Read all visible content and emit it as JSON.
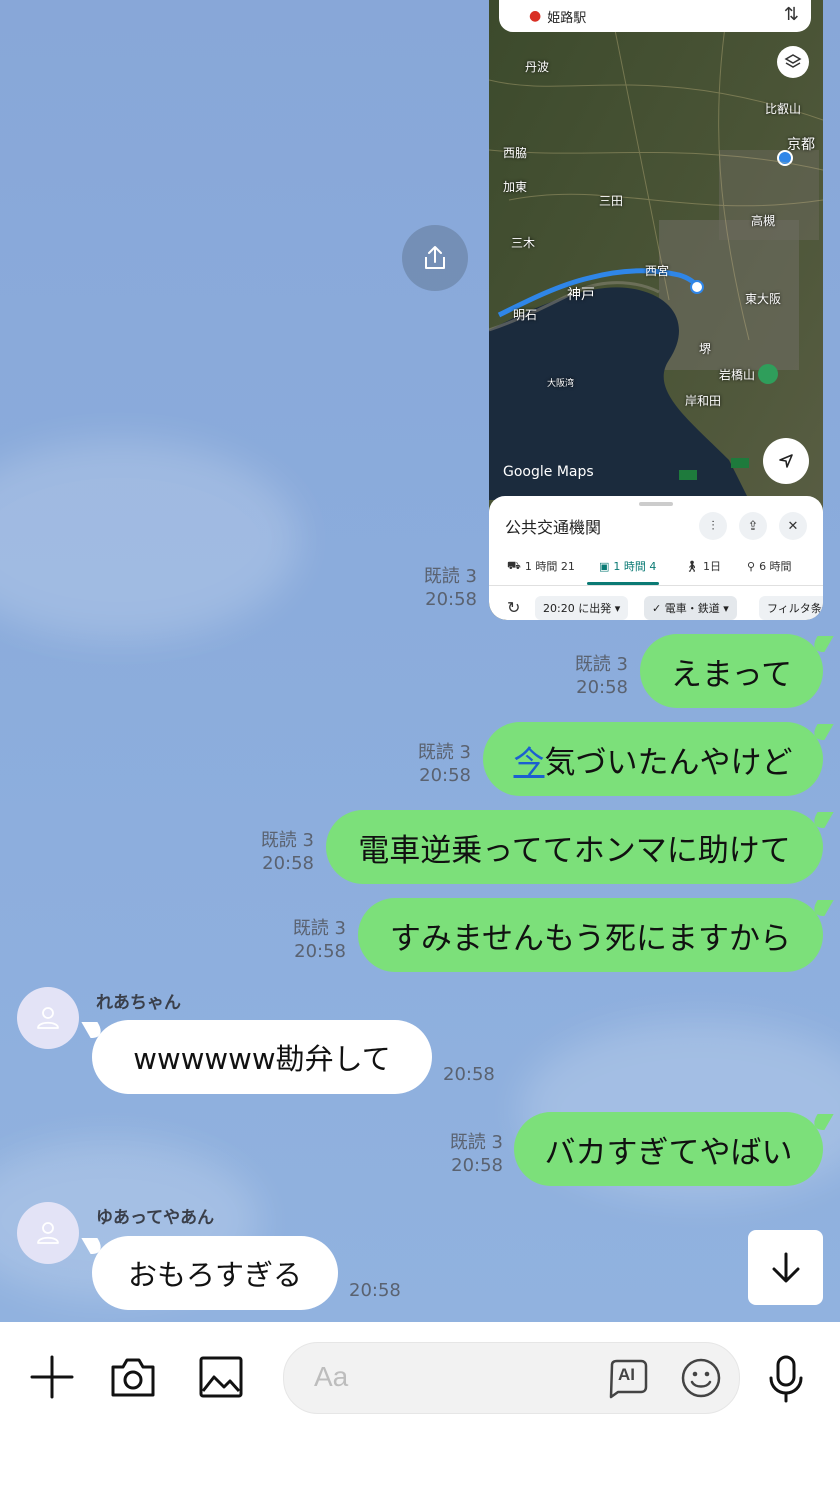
{
  "map": {
    "search_text": "姫路駅",
    "labels": {
      "tanba": "丹波",
      "hieizan": "比叡山",
      "kyoto": "京都",
      "nishiwaki": "西脇",
      "kasai": "加東",
      "sanda": "三田",
      "takatsuki": "高槻",
      "miki": "三木",
      "nishinomiya": "西宮",
      "kobe": "神戸",
      "akashi": "明石",
      "higashiosaka": "東大阪",
      "sakai": "堺",
      "iwawakisan": "岩橋山",
      "osaka_bay": "大阪湾",
      "kishiwada": "岸和田"
    },
    "google_maps": "Google Maps",
    "sheet": {
      "title": "公共交通機関",
      "modes": [
        {
          "label": "1 時間 21",
          "icon": "car-icon"
        },
        {
          "label": "1 時間 4",
          "icon": "train-icon"
        },
        {
          "label": "1日",
          "icon": "walk-icon"
        },
        {
          "label": "6 時間",
          "icon": "bike-icon"
        }
      ],
      "chips": [
        "20:20 に出発",
        "電車・鉄道",
        "フィルタ条"
      ]
    }
  },
  "messages": {
    "m0": {
      "read": "既読 3",
      "time": "20:58"
    },
    "m1": {
      "text": "えまって",
      "read": "既読 3",
      "time": "20:58"
    },
    "m2": {
      "link": "今",
      "text": "気づいたんやけど",
      "read": "既読 3",
      "time": "20:58"
    },
    "m3": {
      "text": "電車逆乗っててホンマに助けて",
      "read": "既読 3",
      "time": "20:58"
    },
    "m4": {
      "text": "すみませんもう死にますから",
      "read": "既読 3",
      "time": "20:58"
    },
    "m5": {
      "sender": "れあちゃん",
      "text": "wwwwww勘弁して",
      "time": "20:58"
    },
    "m6": {
      "text": "バカすぎてやばい",
      "read": "既読 3",
      "time": "20:58"
    },
    "m7": {
      "sender": "ゆあってやあん",
      "text": "おもろすぎる",
      "time": "20:58"
    }
  },
  "input": {
    "placeholder": "Aa",
    "ai_label": "AI"
  },
  "colors": {
    "outgoing_bubble": "#7ce07a",
    "chat_bg": "#8aa8d7",
    "link": "#1c5fd0"
  }
}
